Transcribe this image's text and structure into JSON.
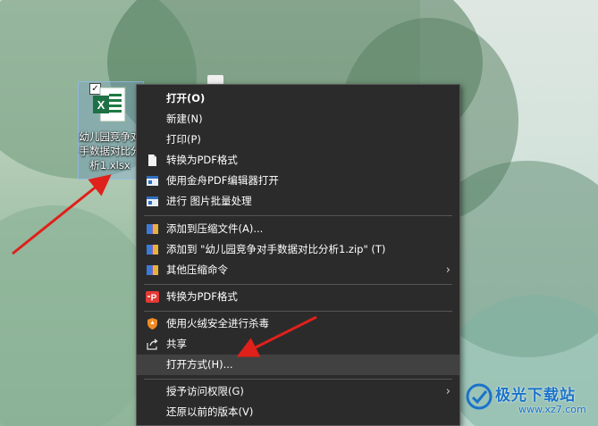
{
  "desktop": {
    "file": {
      "icon": "excel-file-icon",
      "name": "幼儿园竞争对手数据对比分析1.xlsx",
      "name_lines": [
        "幼儿园竞争对",
        "手数据对比分",
        "析1.xlsx"
      ],
      "checked": true
    }
  },
  "context_menu": {
    "items": [
      {
        "label": "打开(O)",
        "icon": "",
        "bold": true
      },
      {
        "label": "新建(N)",
        "icon": ""
      },
      {
        "label": "打印(P)",
        "icon": ""
      },
      {
        "label": "转换为PDF格式",
        "icon": "document-icon"
      },
      {
        "label": "使用金舟PDF编辑器打开",
        "icon": "pdf-editor-icon"
      },
      {
        "label": "进行 图片批量处理",
        "icon": "image-batch-icon"
      },
      {
        "label": "添加到压缩文件(A)...",
        "icon": "archive-icon"
      },
      {
        "label": "添加到 \"幼儿园竞争对手数据对比分析1.zip\" (T)",
        "icon": "archive-icon"
      },
      {
        "label": "其他压缩命令",
        "icon": "archive-icon",
        "submenu": true
      },
      {
        "label": "转换为PDF格式",
        "icon": "pdf-convert-icon"
      },
      {
        "label": "使用火绒安全进行杀毒",
        "icon": "shield-icon"
      },
      {
        "label": "共享",
        "icon": "share-icon"
      },
      {
        "label": "打开方式(H)...",
        "icon": "",
        "highlighted": true
      },
      {
        "label": "授予访问权限(G)",
        "icon": "",
        "submenu": true
      },
      {
        "label": "还原以前的版本(V)",
        "icon": ""
      }
    ],
    "submenu_arrow": "›"
  },
  "watermark": {
    "title": "极光下载站",
    "url": "www.xz7.com"
  },
  "colors": {
    "menu_bg": "#2b2b2b",
    "menu_highlight": "#414141",
    "annotation_red": "#e0201a",
    "watermark_blue": "#1a73c9"
  }
}
